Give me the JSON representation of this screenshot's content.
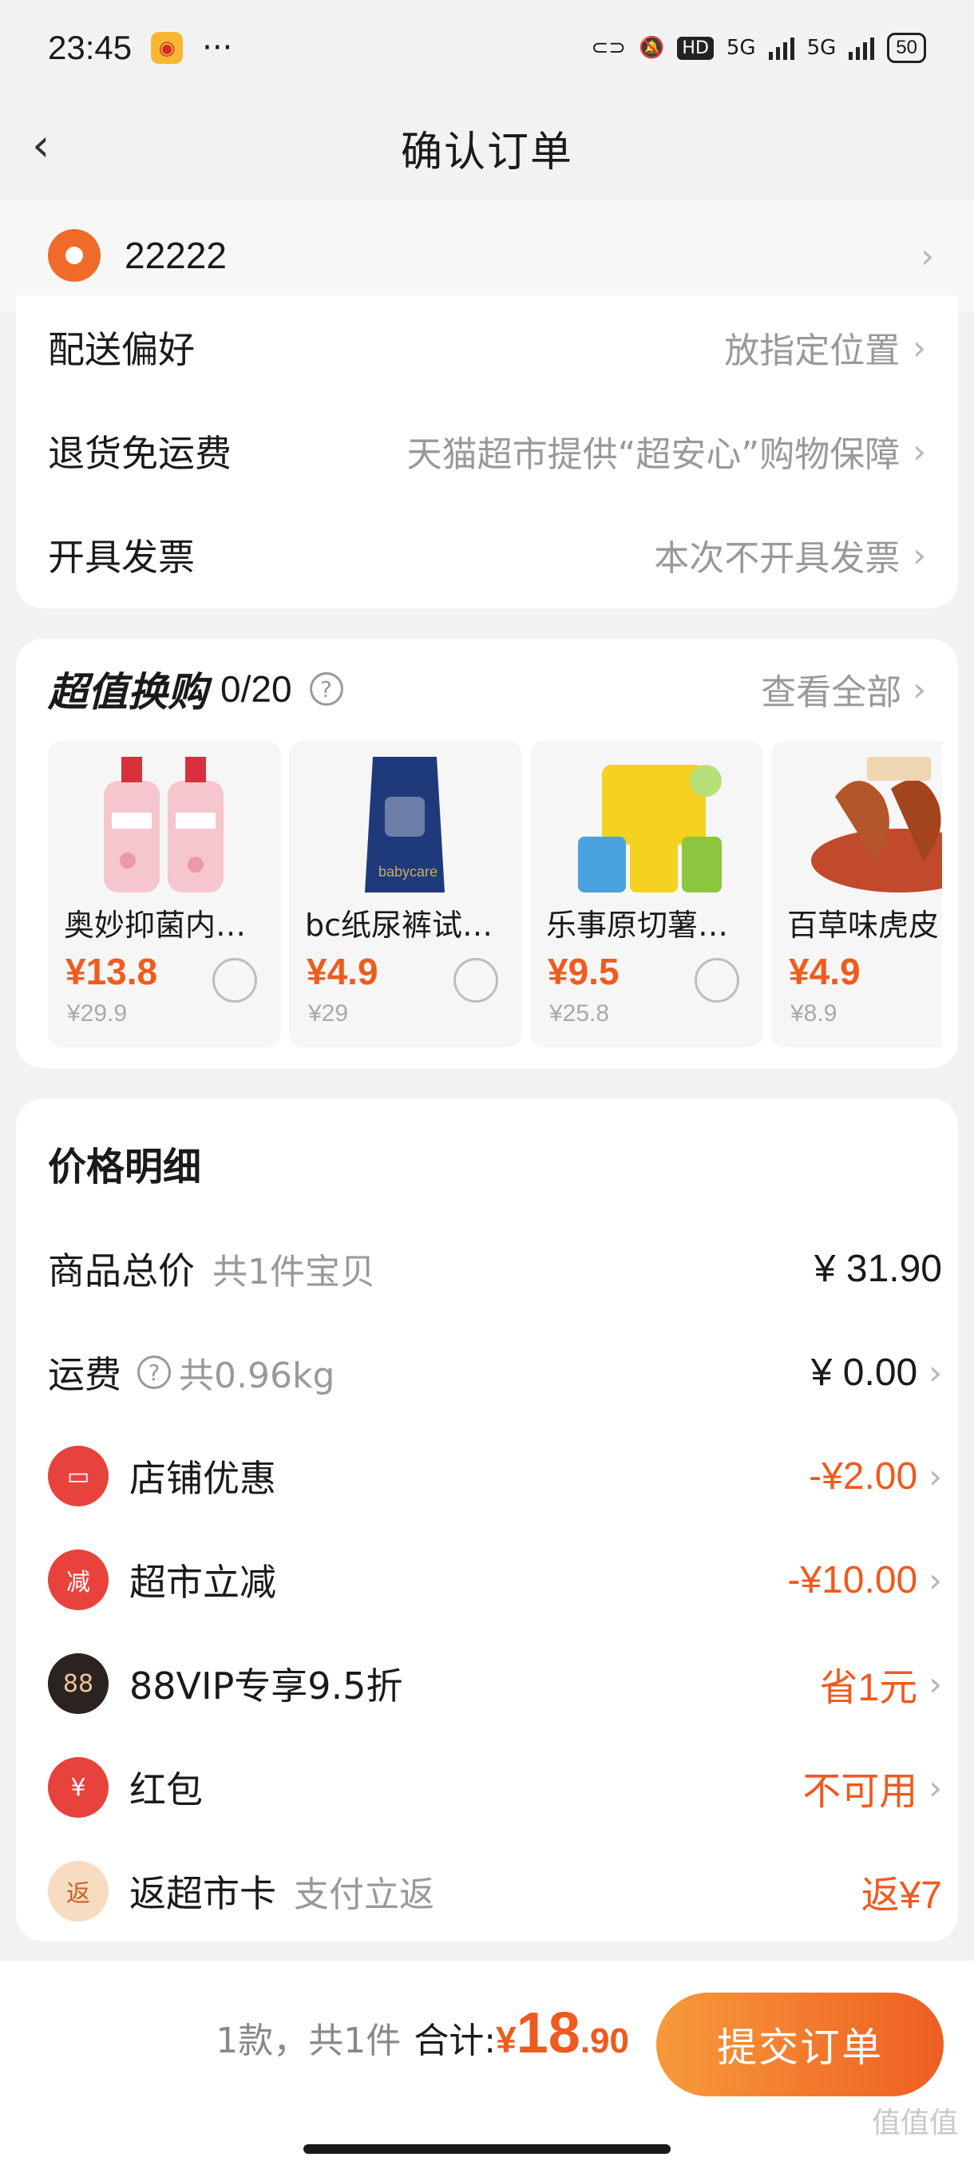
{
  "status_bar": {
    "time": "23:45",
    "dots": "···",
    "hd": "HD",
    "net1": "5G",
    "net2": "5G",
    "battery": "50"
  },
  "nav": {
    "title": "确认订单"
  },
  "address": {
    "text": "22222"
  },
  "options": [
    {
      "label": "配送偏好",
      "value": "放指定位置"
    },
    {
      "label": "退货免运费",
      "value": "天猫超市提供“超安心”购物保障"
    },
    {
      "label": "开具发票",
      "value": "本次不开具发票"
    }
  ],
  "huangou": {
    "title": "超值换购",
    "count": "0/20",
    "view_all": "查看全部",
    "items": [
      {
        "name": "奥妙抑菌内衣…",
        "price": "¥13.8",
        "orig": "¥29.9"
      },
      {
        "name": "bc纸尿裤试…",
        "price": "¥4.9",
        "orig": "¥29"
      },
      {
        "name": "乐事原切薯片…",
        "price": "¥9.5",
        "orig": "¥25.8"
      },
      {
        "name": "百草味虎皮",
        "price": "¥4.9",
        "orig": "¥8.9"
      }
    ]
  },
  "price_detail": {
    "title": "价格明细",
    "goods_total": {
      "label": "商品总价",
      "sub": "共1件宝贝",
      "value": "¥ 31.90"
    },
    "shipping": {
      "label": "运费",
      "sub": "共0.96kg",
      "value": "¥ 0.00"
    },
    "shop_discount": {
      "label": "店铺优惠",
      "value": "-¥2.00"
    },
    "market_cut": {
      "label": "超市立减",
      "icon_text": "减",
      "value": "-¥10.00"
    },
    "vip": {
      "label": "88VIP专享9.5折",
      "icon_text": "88",
      "value": "省1元"
    },
    "red_packet": {
      "label": "红包",
      "icon_text": "¥",
      "value": "不可用"
    },
    "card_back": {
      "label": "返超市卡",
      "sub": "支付立返",
      "icon_text": "返",
      "value": "返¥7"
    }
  },
  "footer": {
    "count": "1款，共1件",
    "total_label": "合计:",
    "yen": "¥",
    "amount_int": "18",
    "amount_dec": ".90",
    "submit": "提交订单"
  },
  "watermark": "值值值",
  "colors": {
    "accent": "#ef5a1f",
    "button_start": "#f79a3b",
    "button_end": "#ee5f22"
  }
}
